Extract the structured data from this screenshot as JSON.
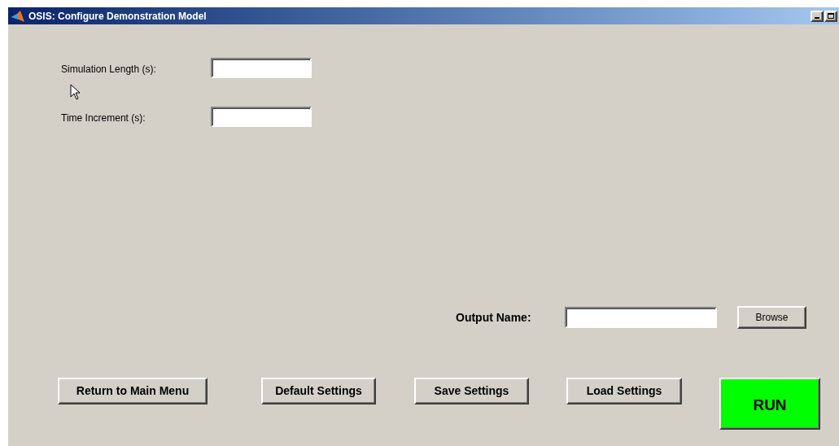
{
  "window": {
    "title": "OSIS: Configure Demonstration Model"
  },
  "fields": [
    {
      "label": "Simulation Length (s):"
    },
    {
      "label": "Time Increment (s):"
    }
  ],
  "output": {
    "label": "Output Name:",
    "browse_button": "Browse"
  },
  "buttons": [
    {
      "label": "Return to Main Menu",
      "kind": "normal"
    },
    {
      "label": "Default Settings",
      "kind": "normal"
    },
    {
      "label": "Save Settings",
      "kind": "normal"
    },
    {
      "label": "Load Settings",
      "kind": "normal"
    },
    {
      "label": "RUN",
      "kind": "run"
    }
  ]
}
